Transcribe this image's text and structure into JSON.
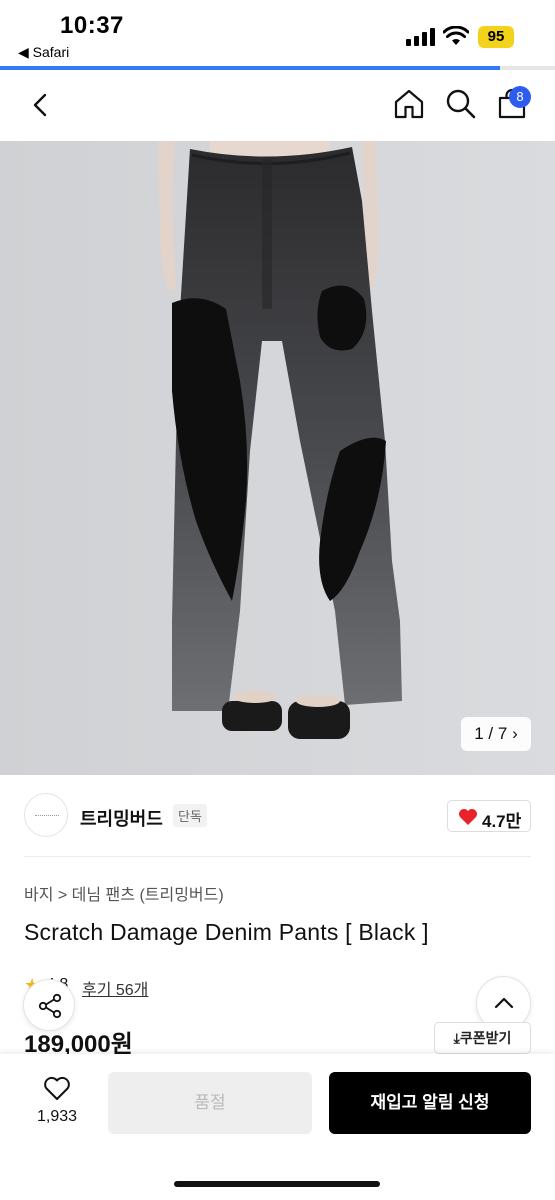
{
  "status_bar": {
    "time": "10:37",
    "back_app": "◀ Safari",
    "battery": "95",
    "icons": [
      "signal-icon",
      "wifi-icon",
      "battery-icon"
    ]
  },
  "page_load_progress": 0.9,
  "nav": {
    "icons": [
      "back-icon",
      "home-icon",
      "search-icon",
      "cart-icon"
    ],
    "cart_badge": "8"
  },
  "gallery": {
    "page_indicator": "1 / 7",
    "image_description": "product photo"
  },
  "brand": {
    "name": "트리밍버드",
    "tag": "단독",
    "likes": "4.7만"
  },
  "product": {
    "breadcrumb": "바지 > 데님 팬츠 (트리밍버드)",
    "title": "Scratch Damage Denim Pants [ Black ]",
    "rating": "4.8",
    "review_link": "후기 56개",
    "price": "189,000원",
    "coupon_label": "⤓쿠폰받기"
  },
  "bottom_bar": {
    "wish_count": "1,933",
    "soldout_label": "품절",
    "restock_label": "재입고 알림 신청"
  },
  "colors": {
    "accent_blue": "#2f7cf6",
    "badge_blue": "#2f5cf0",
    "heart_red": "#e8222b",
    "battery_yellow": "#f2d21b"
  }
}
